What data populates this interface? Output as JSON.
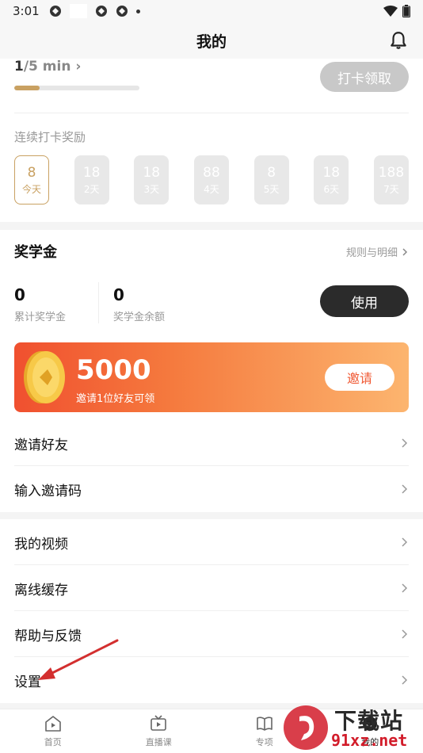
{
  "status_bar": {
    "time": "3:01"
  },
  "navbar": {
    "title": "我的"
  },
  "checkin": {
    "progress_text": "/5 min",
    "progress_num": "1",
    "progress_fraction": 0.2,
    "button_label": "打卡领取",
    "streak_title": "连续打卡奖励",
    "days": [
      {
        "amount": "8",
        "label": "今天",
        "active": true
      },
      {
        "amount": "18",
        "label": "2天"
      },
      {
        "amount": "18",
        "label": "3天"
      },
      {
        "amount": "88",
        "label": "4天"
      },
      {
        "amount": "8",
        "label": "5天"
      },
      {
        "amount": "18",
        "label": "6天"
      },
      {
        "amount": "188",
        "label": "7天"
      }
    ]
  },
  "scholarship": {
    "title": "奖学金",
    "rules_label": "规则与明细",
    "total_value": "0",
    "total_label": "累计奖学金",
    "balance_value": "0",
    "balance_label": "奖学金余额",
    "use_button": "使用",
    "banner": {
      "amount": "5000",
      "subtitle": "邀请1位好友可领",
      "button": "邀请"
    }
  },
  "menu": {
    "invite_friends": "邀请好友",
    "enter_code": "输入邀请码",
    "my_videos": "我的视频",
    "offline_cache": "离线缓存",
    "help_feedback": "帮助与反馈",
    "settings": "设置"
  },
  "bottom_nav": {
    "home": "首页",
    "live": "直播课",
    "topics": "专项",
    "mine": "我的"
  },
  "watermark": {
    "top": "下载站",
    "bottom": "91xz.net"
  },
  "colors": {
    "accent_gold": "#c9a162",
    "banner_start": "#f0502f",
    "banner_end": "#fcb56f",
    "dark_button": "#2b2b2b",
    "arrow": "#d32f2f"
  }
}
